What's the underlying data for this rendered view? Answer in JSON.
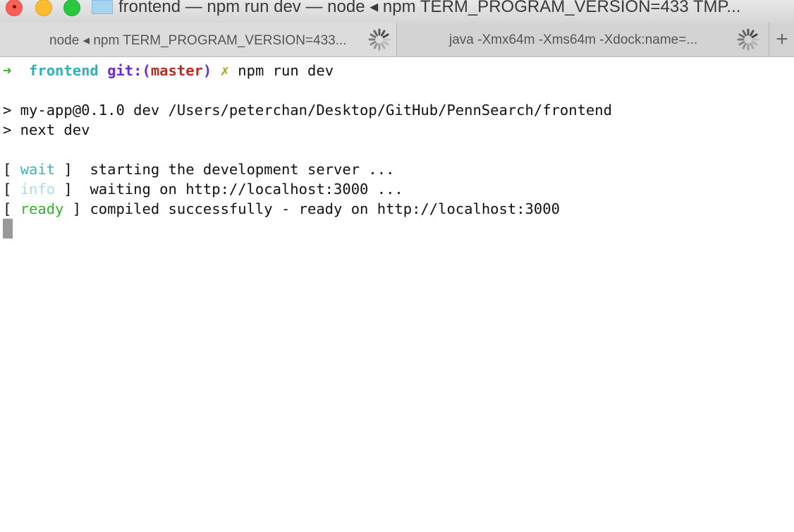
{
  "window": {
    "title": "frontend — npm run dev — node ◂ npm TERM_PROGRAM_VERSION=433 TMP..."
  },
  "tabs": [
    {
      "label": "node ◂ npm TERM_PROGRAM_VERSION=433...",
      "active": true
    },
    {
      "label": "java -Xmx64m -Xms64m -Xdock:name=...",
      "active": false
    }
  ],
  "new_tab_label": "+",
  "terminal": {
    "prompt": {
      "arrow": "➜",
      "dir": "frontend",
      "git_prefix": "git:(",
      "branch": "master",
      "git_suffix": ")",
      "dirty": "✗",
      "command": "npm run dev"
    },
    "lines": [
      "> my-app@0.1.0 dev /Users/peterchan/Desktop/GitHub/PennSearch/frontend",
      "> next dev"
    ],
    "logs": [
      {
        "open": "[ ",
        "tag": "wait",
        "close": " ]  ",
        "message": "starting the development server ..."
      },
      {
        "open": "[ ",
        "tag": "info",
        "close": " ]  ",
        "message": "waiting on http://localhost:3000 ..."
      },
      {
        "open": "[ ",
        "tag": "ready",
        "close": " ] ",
        "message": "compiled successfully - ready on http://localhost:3000"
      }
    ]
  },
  "colors": {
    "accent_green": "#3eac2d",
    "dir_cyan": "#33b0b6",
    "git_purple": "#6b2bd1",
    "branch_red": "#b52d24"
  }
}
